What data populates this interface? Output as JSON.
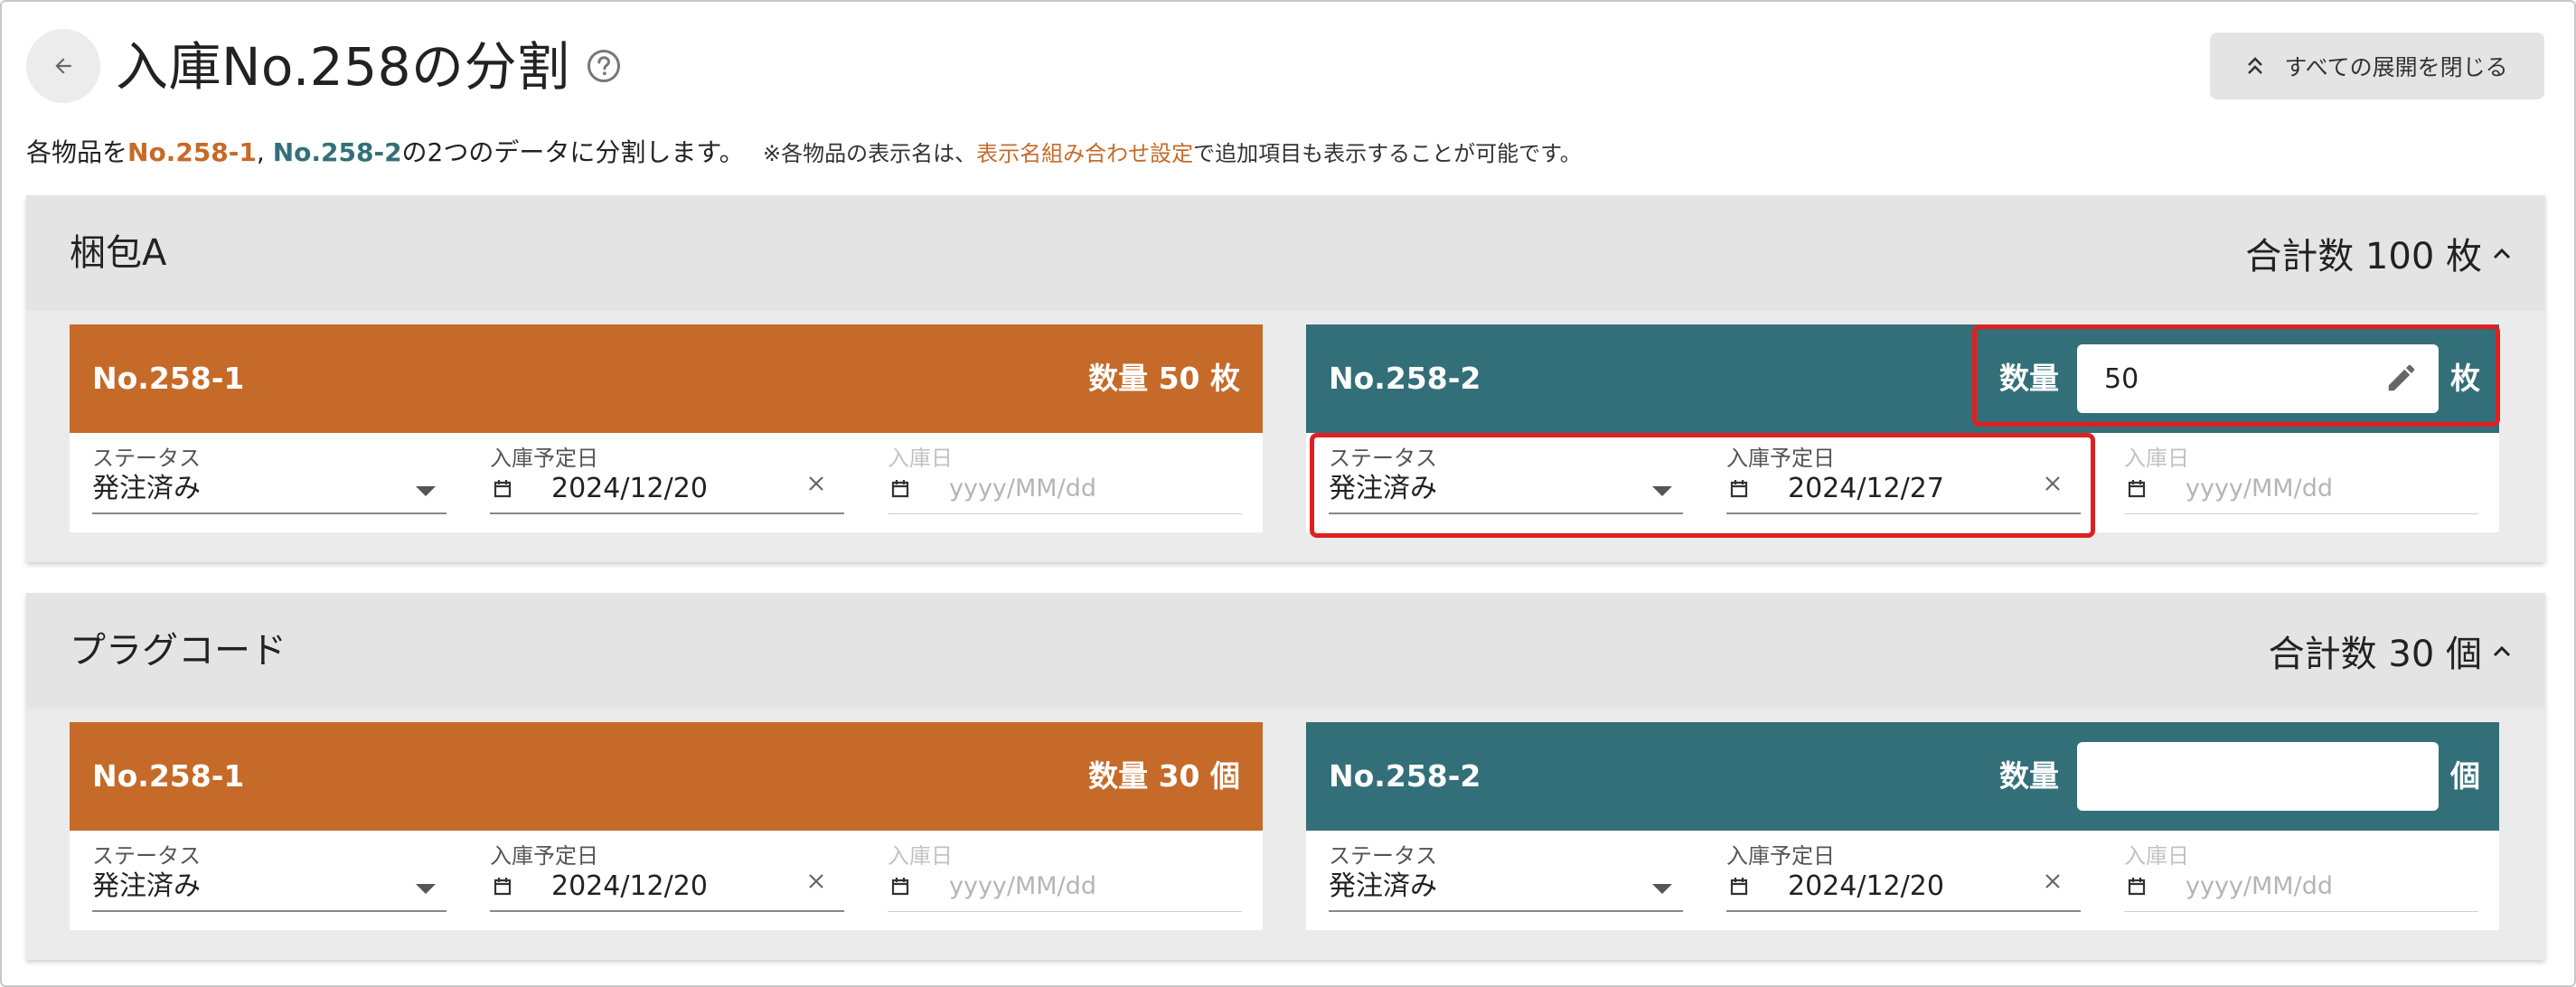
{
  "header": {
    "title": "入庫No.258の分割",
    "collapse_label": "すべての展開を閉じる"
  },
  "description": {
    "prefix": "各物品を",
    "no1": "No.258-1",
    "sep": ", ",
    "no2": "No.258-2",
    "suffix": "の2つのデータに分割します。"
  },
  "note": {
    "prefix": "※各物品の表示名は、",
    "link": "表示名組み合わせ設定",
    "suffix": "で追加項目も表示することが可能です。"
  },
  "labels": {
    "status": "ステータス",
    "scheduled_date": "入庫予定日",
    "received_date": "入庫日",
    "date_placeholder": "yyyy/MM/dd",
    "quantity": "数量"
  },
  "sections": [
    {
      "title": "梱包A",
      "total": "合計数 100 枚",
      "items": [
        {
          "no": "No.258-1",
          "quantity_text": "数量  50 枚",
          "status": "発注済み",
          "scheduled_date": "2024/12/20"
        },
        {
          "no": "No.258-2",
          "quantity_value": "50",
          "unit": "枚",
          "status": "発注済み",
          "scheduled_date": "2024/12/27"
        }
      ]
    },
    {
      "title": "プラグコード",
      "total": "合計数 30 個",
      "items": [
        {
          "no": "No.258-1",
          "quantity_text": "数量  30 個",
          "status": "発注済み",
          "scheduled_date": "2024/12/20"
        },
        {
          "no": "No.258-2",
          "quantity_value": "",
          "unit": "個",
          "status": "発注済み",
          "scheduled_date": "2024/12/20"
        }
      ]
    }
  ],
  "colors": {
    "orange": "#c66a29",
    "teal": "#336f79",
    "highlight": "#e02020"
  },
  "icons": [
    "back-arrow-icon",
    "help-icon",
    "chevrons-up-icon",
    "chevron-up-icon",
    "calendar-icon",
    "clear-icon",
    "dropdown-arrow-icon",
    "pencil-icon"
  ]
}
